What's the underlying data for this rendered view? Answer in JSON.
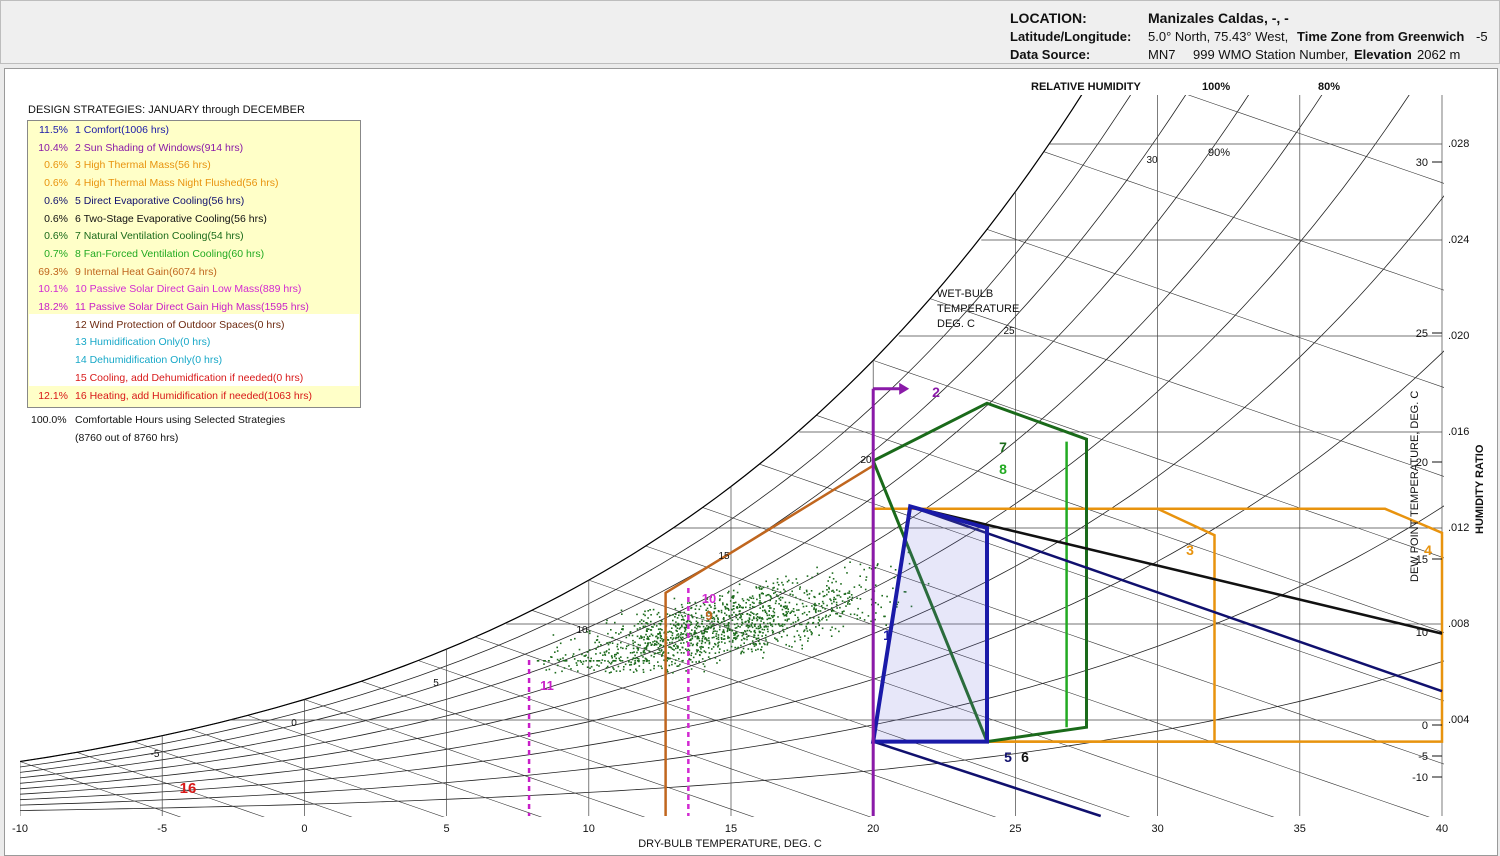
{
  "header": {
    "location_label": "LOCATION:",
    "location_value": "Manizales Caldas, -, -",
    "latlon_label": "Latitude/Longitude:",
    "latlon_value": "5.0° North, 75.43° West,",
    "tz_label": "Time Zone from Greenwich",
    "tz_value": "-5",
    "source_label": "Data Source:",
    "source_code": "MN7",
    "source_station": "999 WMO Station Number,",
    "elev_label": "Elevation",
    "elev_value": "2062 m"
  },
  "legend": {
    "title": "DESIGN STRATEGIES:  JANUARY through DECEMBER",
    "items": [
      {
        "pct": "11.5%",
        "label": "1 Comfort(1006 hrs)",
        "color": "#1a1aa8"
      },
      {
        "pct": "10.4%",
        "label": "2 Sun Shading of Windows(914 hrs)",
        "color": "#8a1aa8"
      },
      {
        "pct": "0.6%",
        "label": "3 High Thermal Mass(56 hrs)",
        "color": "#e8930e"
      },
      {
        "pct": "0.6%",
        "label": "4 High Thermal Mass Night Flushed(56 hrs)",
        "color": "#e8930e"
      },
      {
        "pct": "0.6%",
        "label": "5 Direct Evaporative Cooling(56 hrs)",
        "color": "#10106e"
      },
      {
        "pct": "0.6%",
        "label": "6 Two-Stage Evaporative Cooling(56 hrs)",
        "color": "#111111"
      },
      {
        "pct": "0.6%",
        "label": "7 Natural Ventilation Cooling(54 hrs)",
        "color": "#1a6a1a"
      },
      {
        "pct": "0.7%",
        "label": "8 Fan-Forced Ventilation Cooling(60 hrs)",
        "color": "#22aa22"
      },
      {
        "pct": "69.3%",
        "label": "9 Internal Heat Gain(6074 hrs)",
        "color": "#c0661e"
      },
      {
        "pct": "10.1%",
        "label": "10 Passive Solar Direct Gain Low Mass(889 hrs)",
        "color": "#d22ad2"
      },
      {
        "pct": "18.2%",
        "label": "11 Passive Solar Direct Gain High Mass(1595 hrs)",
        "color": "#c81ec8"
      },
      {
        "pct": "",
        "label": "12 Wind Protection of Outdoor Spaces(0 hrs)",
        "color": "#6e2a10"
      },
      {
        "pct": "",
        "label": "13 Humidification Only(0 hrs)",
        "color": "#18a8c8"
      },
      {
        "pct": "",
        "label": "14 Dehumidification Only(0 hrs)",
        "color": "#18a8c8"
      },
      {
        "pct": "",
        "label": "15 Cooling, add Dehumidfication if needed(0 hrs)",
        "color": "#d81818"
      },
      {
        "pct": "12.1%",
        "label": "16 Heating, add Humidification if needed(1063 hrs)",
        "color": "#d81818"
      }
    ],
    "total_pct": "100.0%",
    "total_label": "Comfortable Hours using Selected Strategies",
    "total_sub": "(8760 out of 8760 hrs)"
  },
  "chart_data": {
    "type": "scatter",
    "xlabel": "DRY-BULB TEMPERATURE, DEG. C",
    "ylabel": "HUMIDITY RATIO",
    "dewpoint_label": "DEW POINT TEMPERATURE, DEG. C",
    "wetbulb_label": [
      "WET-BULB",
      "TEMPERATURE",
      "DEG. C"
    ],
    "rh_title": "RELATIVE HUMIDITY",
    "rh_top_labels": [
      "100%",
      "80%"
    ],
    "rh_inner_label": "90%",
    "xlim": [
      -10,
      40
    ],
    "ylim": [
      0,
      0.03
    ],
    "x_ticks": [
      "-10",
      "-5",
      "0",
      "5",
      "10",
      "15",
      "20",
      "25",
      "30",
      "35",
      "40"
    ],
    "w_ticks": [
      ".004",
      ".008",
      ".012",
      ".016",
      ".020",
      ".024",
      ".028"
    ],
    "dewpoint_ticks": [
      "-10",
      "-5",
      "0",
      "10",
      "15",
      "20",
      "25",
      "30"
    ],
    "wetbulb_ticks": [
      "-5",
      "0",
      "5",
      "10",
      "15",
      "20",
      "25",
      "30"
    ],
    "hourly_points_cloud": {
      "db_range": [
        8,
        27
      ],
      "w_range": [
        0.0065,
        0.0125
      ],
      "approx_count": 1400
    },
    "zones": [
      {
        "id": "1",
        "name": "Comfort",
        "db": [
          20,
          21.3,
          24,
          24
        ],
        "w": [
          0.0031,
          0.0129,
          0.012,
          0.0031
        ]
      },
      {
        "id": "2",
        "name": "Sun Shading",
        "boundary_db": 20
      },
      {
        "id": "3",
        "name": "High Thermal Mass",
        "db": [
          20,
          30,
          32,
          32,
          20
        ],
        "w": [
          0.0128,
          0.0128,
          0.0117,
          0.0031,
          0.0031
        ]
      },
      {
        "id": "4",
        "name": "High Thermal Mass Night Flushed",
        "db": [
          20,
          38,
          40,
          40,
          20
        ],
        "w": [
          0.0128,
          0.0128,
          0.0118,
          0.0031,
          0.0031
        ]
      },
      {
        "id": "7",
        "name": "Natural Ventilation",
        "db": [
          20,
          24,
          27.5,
          27.5,
          24
        ],
        "w": [
          0.0148,
          0.0172,
          0.0157,
          0.0037,
          0.0031
        ]
      },
      {
        "id": "8",
        "name": "Fan-Forced Ventilation",
        "db": [
          26.8,
          26.8
        ],
        "w": [
          0.0156,
          0.0037
        ]
      },
      {
        "id": "9",
        "name": "Internal Heat Gain",
        "db": [
          12.7,
          12.7,
          20,
          20
        ],
        "w": [
          0,
          0.0093,
          0.0146,
          0
        ]
      },
      {
        "id": "10",
        "name": "Passive Solar Low Mass",
        "boundary_db": 13.5
      },
      {
        "id": "11",
        "name": "Passive Solar High Mass",
        "boundary_db": 7.9
      },
      {
        "id": "16",
        "name": "Heating",
        "region": "below 12.7 C"
      }
    ]
  }
}
